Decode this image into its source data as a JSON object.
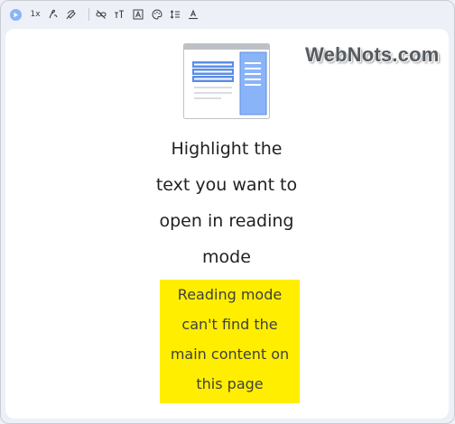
{
  "toolbar": {
    "speed_label": "1x"
  },
  "watermark": "WebNots.com",
  "main": {
    "message_lines": [
      "Highlight the",
      "text you want to",
      "open in reading",
      "mode"
    ],
    "notice_lines": [
      "Reading mode",
      "can't find the",
      "main content on",
      "this page"
    ]
  },
  "colors": {
    "highlight": "#ffee00",
    "play_button": "#8ab4f8",
    "illustration_accent": "#5b8ee6"
  },
  "icons": [
    "play-icon",
    "voice-icon",
    "pen-highlight-icon",
    "link-off-icon",
    "text-size-icon",
    "font-icon",
    "palette-icon",
    "line-spacing-icon",
    "letter-spacing-icon"
  ]
}
